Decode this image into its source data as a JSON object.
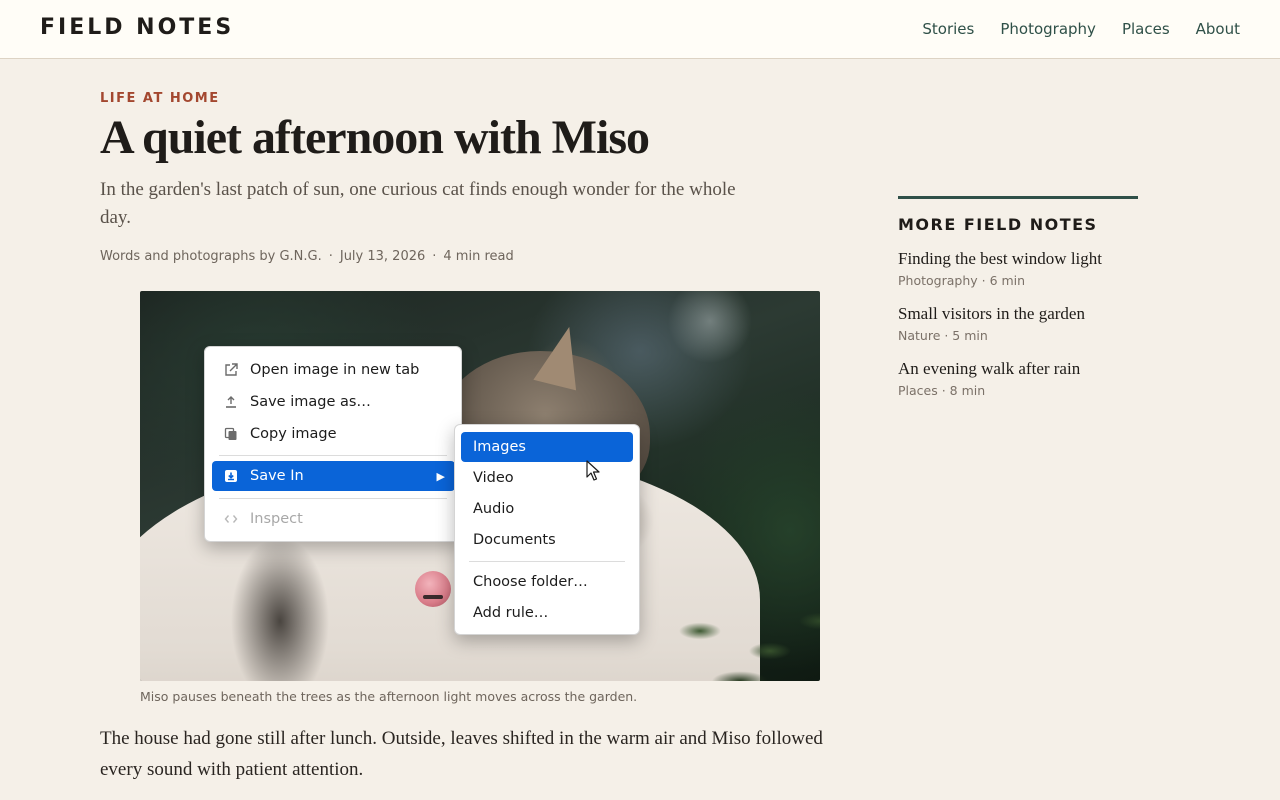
{
  "site": {
    "brand": "FIELD NOTES",
    "nav": [
      "Stories",
      "Photography",
      "Places",
      "About"
    ]
  },
  "article": {
    "kicker": "LIFE AT HOME",
    "title": "A quiet afternoon with Miso",
    "dek": "In the garden's last patch of sun, one curious cat finds enough wonder for the whole day.",
    "byline": "Words and photographs by G.N.G.",
    "date": "July 13, 2026",
    "read_time": "4 min read",
    "byline_sep": "·",
    "caption": "Miso pauses beneath the trees as the afternoon light moves across the garden.",
    "body": "The house had gone still after lunch. Outside, leaves shifted in the warm air and Miso followed every sound with patient attention."
  },
  "sidebar": {
    "heading": "MORE FIELD NOTES",
    "items": [
      {
        "title": "Finding the best window light",
        "meta": "Photography · 6 min"
      },
      {
        "title": "Small visitors in the garden",
        "meta": "Nature · 5 min"
      },
      {
        "title": "An evening walk after rain",
        "meta": "Places · 8 min"
      }
    ]
  },
  "context_menu": {
    "items": [
      {
        "label": "Open image in new tab",
        "icon": "external-link-icon"
      },
      {
        "label": "Save image as…",
        "icon": "upload-icon"
      },
      {
        "label": "Copy image",
        "icon": "copy-icon"
      },
      {
        "label": "Save In",
        "icon": "download-box-icon",
        "arrow": "▶",
        "state": "highlighted"
      },
      {
        "label": "Inspect",
        "icon": "code-icon",
        "state": "disabled"
      }
    ],
    "submenu": {
      "items": [
        "Images",
        "Video",
        "Audio",
        "Documents"
      ],
      "extra": [
        "Choose folder…",
        "Add rule…"
      ],
      "highlighted": "Images"
    }
  },
  "colors": {
    "accent_blue": "#0a64d8",
    "kicker_red": "#a3472f",
    "nav_green": "#2f5048",
    "page_bg": "#f5f0e8"
  }
}
